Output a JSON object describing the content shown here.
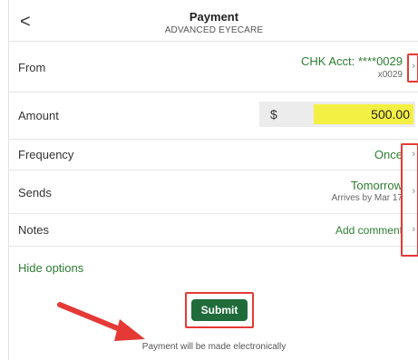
{
  "header": {
    "back_glyph": "<",
    "title": "Payment",
    "subtitle": "ADVANCED EYECARE"
  },
  "from": {
    "label": "From",
    "account": "CHK Acct: ****0029",
    "account_short": "x0029"
  },
  "amount": {
    "label": "Amount",
    "currency": "$",
    "value": "500.00"
  },
  "frequency": {
    "label": "Frequency",
    "value": "Once"
  },
  "sends": {
    "label": "Sends",
    "value": "Tomorrow",
    "arrives": "Arrives by Mar 17"
  },
  "notes": {
    "label": "Notes",
    "value": "Add comment"
  },
  "hide_options_label": "Hide options",
  "submit_label": "Submit",
  "footer_text": "Payment will be made electronically",
  "chevron_glyph": "›",
  "colors": {
    "accent_green": "#2e7d32",
    "submit_green": "#1f6b3a",
    "highlight_yellow": "#f4f043",
    "annotation_red": "#e53935"
  }
}
